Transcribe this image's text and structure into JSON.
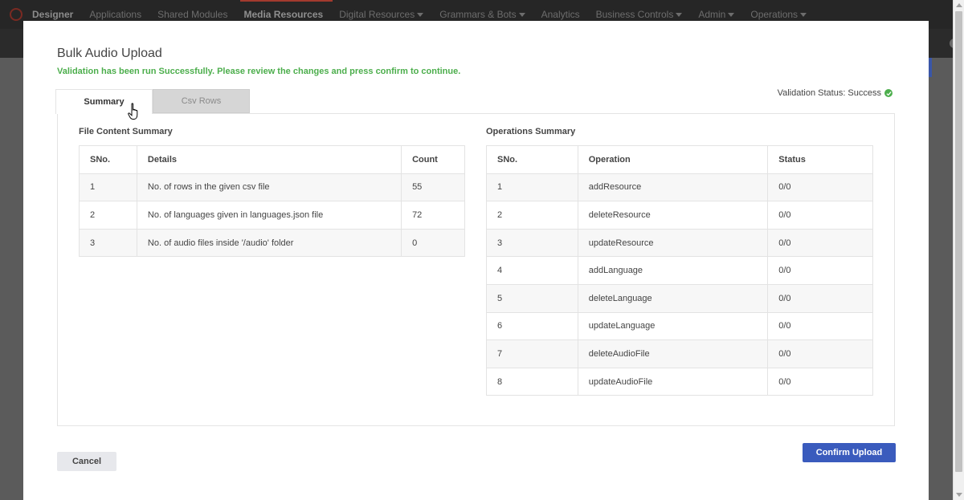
{
  "nav": {
    "brand": "Designer",
    "items": [
      {
        "label": "Applications",
        "caret": false
      },
      {
        "label": "Shared Modules",
        "caret": false
      },
      {
        "label": "Media Resources",
        "caret": false,
        "active": true
      },
      {
        "label": "Digital Resources",
        "caret": true
      },
      {
        "label": "Grammars & Bots",
        "caret": true
      },
      {
        "label": "Analytics",
        "caret": false
      },
      {
        "label": "Business Controls",
        "caret": true
      },
      {
        "label": "Admin",
        "caret": true
      },
      {
        "label": "Operations",
        "caret": true
      }
    ]
  },
  "modal": {
    "title": "Bulk Audio Upload",
    "message": "Validation has been run Successfully. Please review the changes and press confirm to continue.",
    "tabs": {
      "summary": "Summary",
      "csv_rows": "Csv Rows"
    },
    "validation_status": "Validation Status: Success",
    "file_content": {
      "title": "File Content Summary",
      "headers": [
        "SNo.",
        "Details",
        "Count"
      ],
      "rows": [
        [
          "1",
          "No. of rows in the given csv file",
          "55"
        ],
        [
          "2",
          "No. of languages given in languages.json file",
          "72"
        ],
        [
          "3",
          "No. of audio files inside '/audio' folder",
          "0"
        ]
      ]
    },
    "operations": {
      "title": "Operations Summary",
      "headers": [
        "SNo.",
        "Operation",
        "Status"
      ],
      "rows": [
        [
          "1",
          "addResource",
          "0/0"
        ],
        [
          "2",
          "deleteResource",
          "0/0"
        ],
        [
          "3",
          "updateResource",
          "0/0"
        ],
        [
          "4",
          "addLanguage",
          "0/0"
        ],
        [
          "5",
          "deleteLanguage",
          "0/0"
        ],
        [
          "6",
          "updateLanguage",
          "0/0"
        ],
        [
          "7",
          "deleteAudioFile",
          "0/0"
        ],
        [
          "8",
          "updateAudioFile",
          "0/0"
        ]
      ]
    },
    "buttons": {
      "cancel": "Cancel",
      "confirm": "Confirm Upload"
    }
  },
  "colors": {
    "success": "#4cae4c",
    "primary": "#3a5bbd",
    "overlay": "#5b5b5b"
  }
}
